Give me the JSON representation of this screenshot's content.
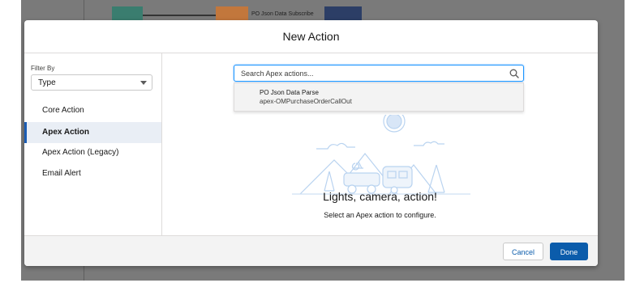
{
  "background": {
    "flow_label": "PO Json Data Subscribe"
  },
  "modal": {
    "title": "New Action"
  },
  "filter": {
    "label": "Filter By",
    "selected": "Type",
    "items": [
      "Core Action",
      "Apex Action",
      "Apex Action (Legacy)",
      "Email Alert"
    ],
    "active_item": "Apex Action"
  },
  "search": {
    "placeholder": "Search Apex actions...",
    "value": ""
  },
  "dropdown": {
    "option_title": "PO Json Data Parse",
    "option_subtitle": "apex-OMPurchaseOrderCallOut"
  },
  "empty_state": {
    "title": "Lights, camera, action!",
    "subtitle": "Select an Apex action to configure."
  },
  "footer": {
    "cancel_label": "Cancel",
    "done_label": "Done"
  },
  "colors": {
    "brand": "#0b5cab",
    "active_indicator": "#1b5db4",
    "illustration": "#d8e6f7"
  }
}
